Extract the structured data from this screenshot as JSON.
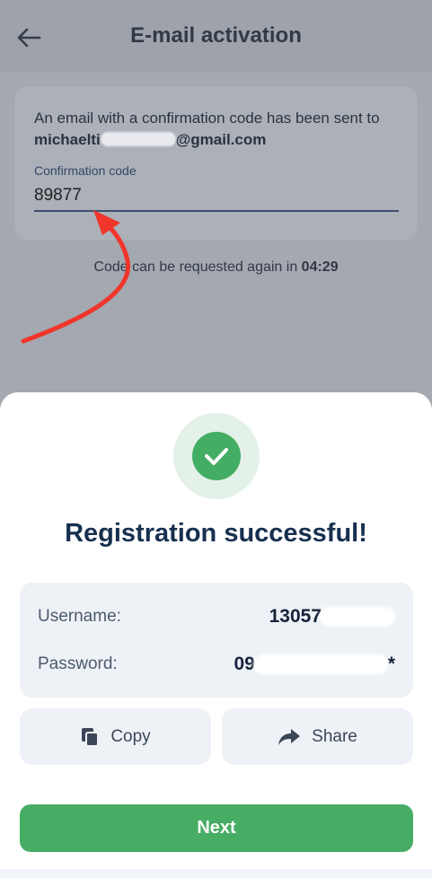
{
  "header": {
    "title": "E-mail activation",
    "back_icon": "arrow-left-icon"
  },
  "email_card": {
    "message_prefix": "An email with a confirmation code has been sent to ",
    "email_start": "michaelti",
    "email_end": "@gmail.com",
    "code_label": "Confirmation code",
    "code_value": "89877"
  },
  "resend": {
    "prefix": "Code can be requested again in ",
    "timer": "04:29"
  },
  "sheet": {
    "success_icon": "check-circle-icon",
    "title": "Registration successful!",
    "credentials": {
      "username_label": "Username:",
      "username_value": "13057",
      "password_label": "Password:",
      "password_value_start": "09",
      "password_value_end": "*"
    },
    "copy_label": "Copy",
    "share_label": "Share",
    "next_label": "Next"
  },
  "colors": {
    "accent_green": "#47ac64",
    "title_navy": "#17304f",
    "annotation_red": "#f0352b"
  }
}
